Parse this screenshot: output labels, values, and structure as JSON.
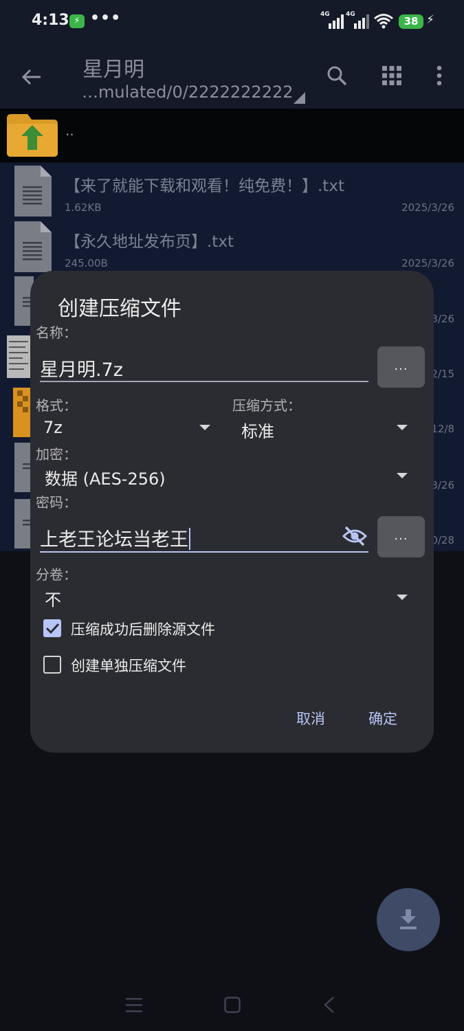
{
  "status_bar": {
    "time": "4:13",
    "charge_icon": "lightning-icon",
    "more_dots": "•••",
    "signal1_label": "4G",
    "signal2_label": "4G",
    "battery_level": "38",
    "charging_icon": "⚡"
  },
  "app_bar": {
    "title": "星月明",
    "path": "…mulated/0/2222222222"
  },
  "file_list": {
    "parent_label": "..",
    "items": [
      {
        "name": "【来了就能下载和观看！纯免费！】.txt",
        "size": "1.62KB",
        "date": "2025/3/26"
      },
      {
        "name": "【永久地址发布页】.txt",
        "size": "245.00B",
        "date": "2025/3/26"
      }
    ],
    "hidden_dates": [
      "3/26",
      "2/15",
      "12/8",
      "3/26",
      "0/28"
    ]
  },
  "dialog": {
    "title": "创建压缩文件",
    "name_label": "名称：",
    "name_value": "星月明.7z",
    "more_label": "...",
    "format_label": "格式：",
    "format_value": "7z",
    "method_label": "压缩方式：",
    "method_value": "标准",
    "encryption_label": "加密：",
    "encryption_value": "数据 (AES-256)",
    "password_label": "密码：",
    "password_value": "上老王论坛当老王",
    "split_label": "分卷：",
    "split_value": "不",
    "delete_source_label": "压缩成功后删除源文件",
    "delete_source_checked": true,
    "separate_label": "创建单独压缩文件",
    "separate_checked": false,
    "cancel_label": "取消",
    "ok_label": "确定"
  },
  "colors": {
    "accent": "#b8c4f5",
    "dialog_bg": "#2b2c31",
    "list_bg": "#121a31",
    "battery": "#3bb54a"
  }
}
